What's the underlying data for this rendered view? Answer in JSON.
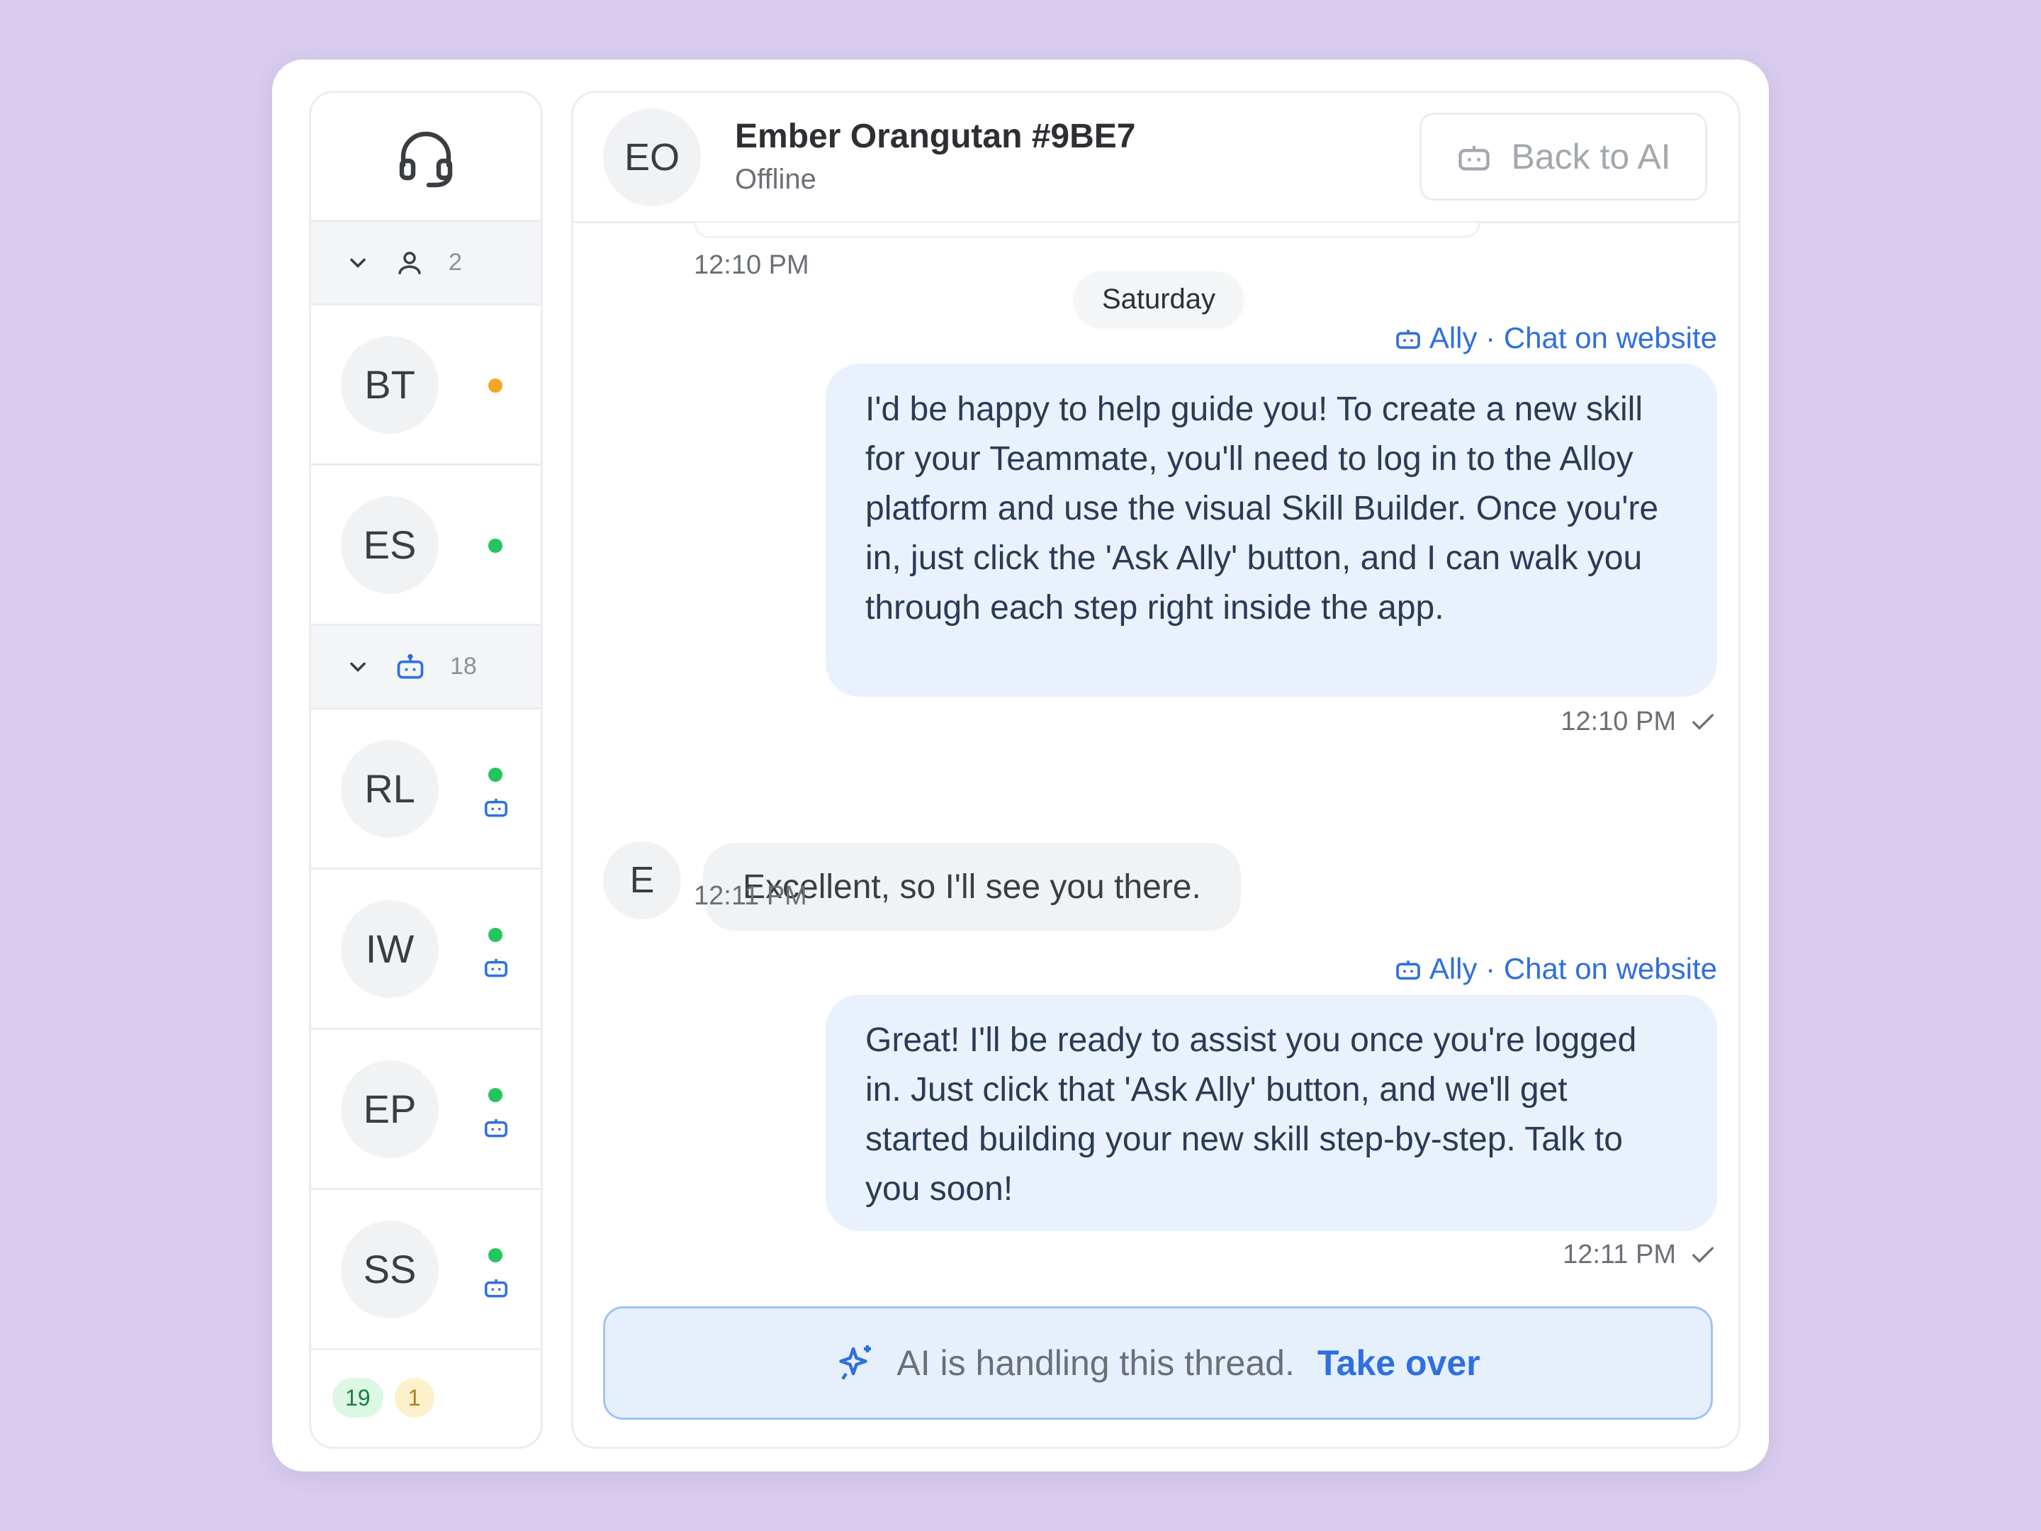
{
  "sidebar": {
    "groups": [
      {
        "icon": "user-icon",
        "count": "2"
      },
      {
        "icon": "bot-icon",
        "count": "18"
      }
    ],
    "items": [
      {
        "initials": "BT",
        "status": "orange"
      },
      {
        "initials": "ES",
        "status": "green"
      },
      {
        "initials": "RL",
        "status": "green",
        "bot": true
      },
      {
        "initials": "IW",
        "status": "green",
        "bot": true
      },
      {
        "initials": "EP",
        "status": "green",
        "bot": true
      },
      {
        "initials": "SS",
        "status": "green",
        "bot": true
      }
    ],
    "footer": {
      "green_count": "19",
      "yellow_count": "1"
    }
  },
  "header": {
    "initials": "EO",
    "name": "Ember Orangutan #9BE7",
    "status": "Offline",
    "back_button": "Back to AI"
  },
  "messages": {
    "prev_time": "12:10 PM",
    "day": "Saturday",
    "ai_1": {
      "sender": "Ally · Chat on website",
      "text": "I'd be happy to help guide you! To create a new skill for your Teammate, you'll need to log in to the Alloy platform and use the visual Skill Builder. Once you're in, just click the 'Ask Ally' button, and I can walk you through each step right inside the app.",
      "time": "12:10 PM"
    },
    "user_1": {
      "initial": "E",
      "text": "Excellent, so I'll see you there.",
      "time": "12:11 PM"
    },
    "ai_2": {
      "sender": "Ally · Chat on website",
      "text": "Great! I'll be ready to assist you once you're logged in. Just click that 'Ask Ally' button, and we'll get started building your new skill step-by-step. Talk to you soon!",
      "time": "12:11 PM"
    }
  },
  "banner": {
    "text": "AI is handling this thread.",
    "action": "Take over"
  },
  "colors": {
    "accent": "#2f6fe0",
    "online": "#22c55e",
    "away": "#f5a524",
    "background": "#d8cdee"
  }
}
